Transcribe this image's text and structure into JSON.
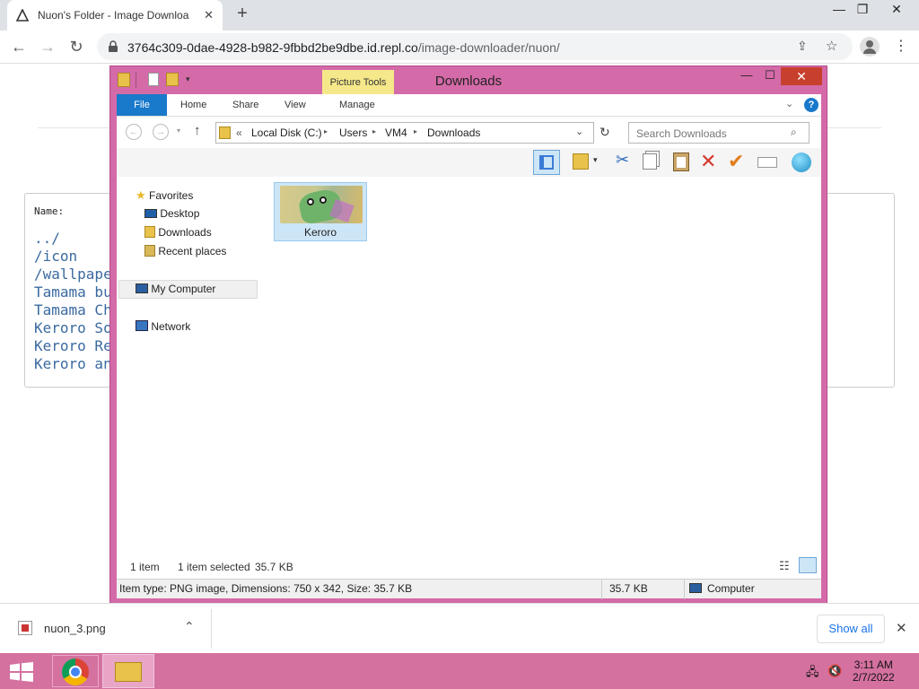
{
  "browser": {
    "tab_title": "Nuon's Folder - Image Downloa",
    "url_host": "3764c309-0dae-4928-b982-9fbbd2be9dbe.id.repl.co",
    "url_path": "/image-downloader/nuon/"
  },
  "webpage": {
    "name_label": "Name:",
    "items": [
      "../",
      "/icon",
      "/wallpape",
      "Tamama bu",
      "Tamama Ch",
      "Keroro So",
      "Keroro Re",
      "Keroro an"
    ]
  },
  "explorer": {
    "title": "Downloads",
    "picture_tools": "Picture Tools",
    "ribbon_tabs": {
      "file": "File",
      "home": "Home",
      "share": "Share",
      "view": "View",
      "manage": "Manage"
    },
    "breadcrumb": {
      "prefix": "«",
      "c1": "Local Disk (C:)",
      "c2": "Users",
      "c3": "VM4",
      "c4": "Downloads"
    },
    "search_placeholder": "Search Downloads",
    "nav": {
      "favorites": "Favorites",
      "desktop": "Desktop",
      "downloads": "Downloads",
      "recent": "Recent places",
      "mycomputer": "My Computer",
      "network": "Network"
    },
    "file_name": "Keroro",
    "status": {
      "count": "1 item",
      "selected": "1 item selected",
      "size": "35.7 KB"
    },
    "details": {
      "info": "Item type: PNG image, Dimensions: 750 x 342, Size: 35.7 KB",
      "size": "35.7 KB",
      "location": "Computer"
    }
  },
  "download_bar": {
    "file": "nuon_3.png",
    "show_all": "Show all"
  },
  "taskbar": {
    "time": "3:11 AM",
    "date": "2/7/2022"
  },
  "colors": {
    "window_frame": "#d46aa8",
    "file_tab": "#1979ca",
    "taskbar": "#d4719f",
    "link": "#1a73e8"
  }
}
